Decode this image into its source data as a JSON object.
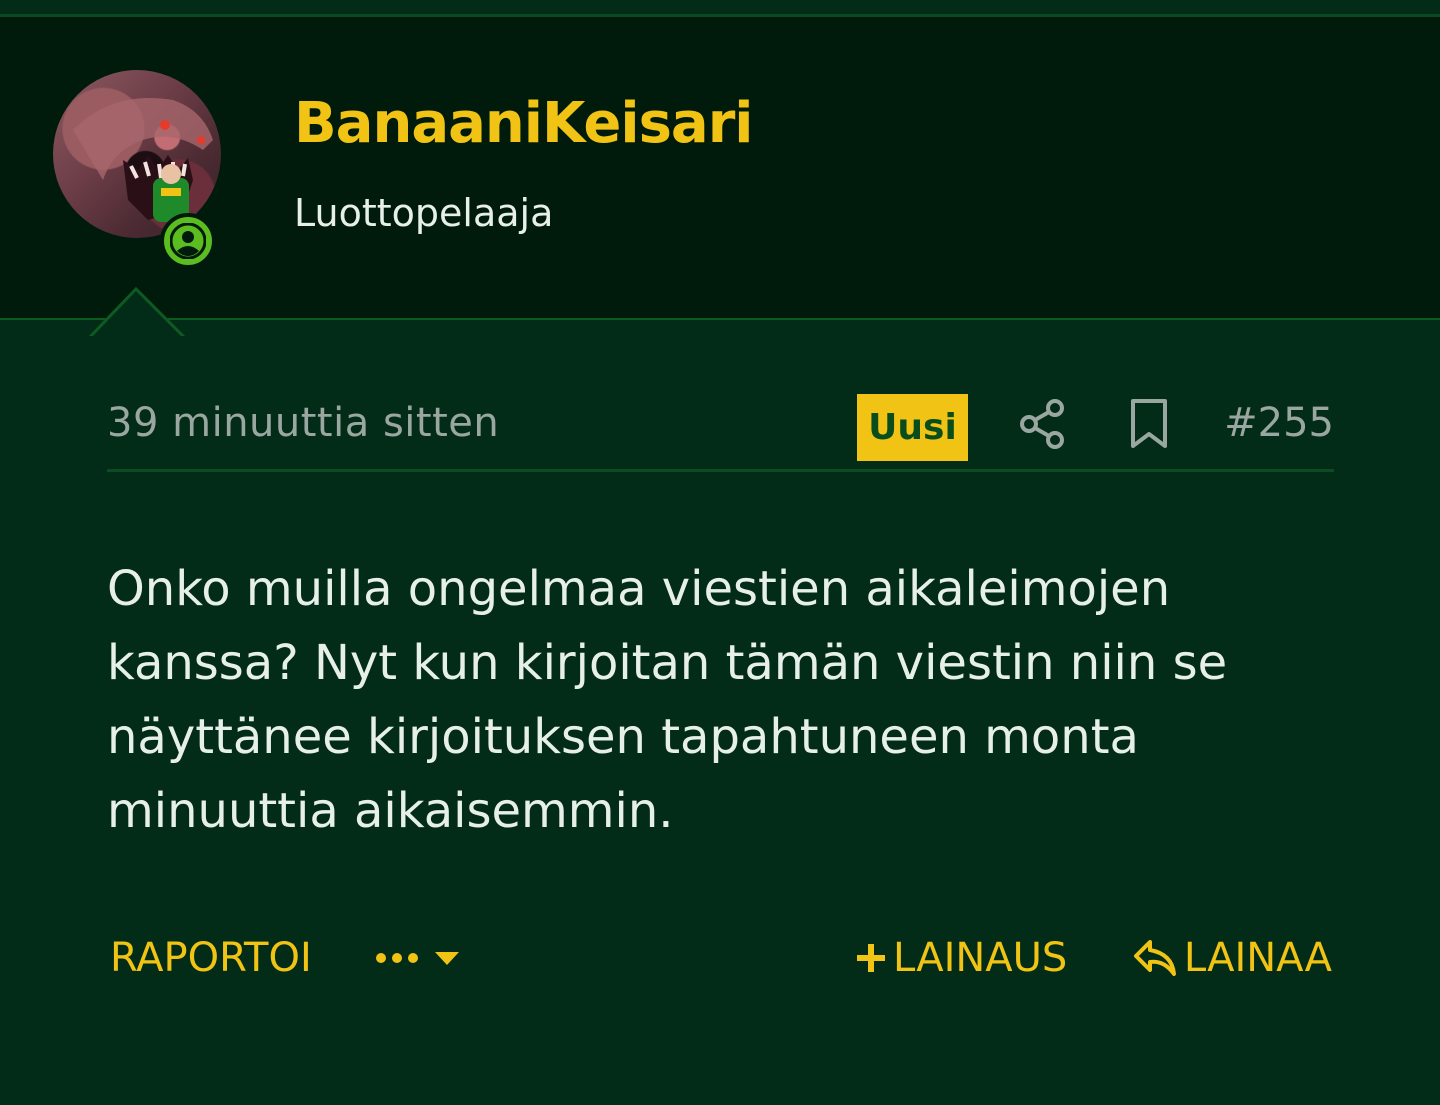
{
  "colors": {
    "background": "#022c17",
    "header_background": "#001b0c",
    "accent_yellow": "#f0c314",
    "text_light": "#e7efe9",
    "text_muted": "#9aa6a0",
    "online_green": "#5bbd1f"
  },
  "user": {
    "avatar_icon": "user-avatar-image",
    "online_icon": "user-online-icon",
    "name": "BanaaniKeisari",
    "title": "Luottopelaaja"
  },
  "post": {
    "timestamp": "39 minuuttia sitten",
    "new_badge": "Uusi",
    "share_icon": "share-icon",
    "bookmark_icon": "bookmark-icon",
    "number": "#255",
    "body": "Onko muilla ongelmaa viestien aikaleimojen kanssa? Nyt kun kirjoitan tämän viestin niin se näyttänee kirjoituksen tapahtuneen monta minuuttia aikaisemmin."
  },
  "actions": {
    "report_label": "RAPORTOI",
    "more_icon": "more-dots-icon",
    "quote_add_label": "LAINAUS",
    "reply_label": "LAINAA"
  }
}
